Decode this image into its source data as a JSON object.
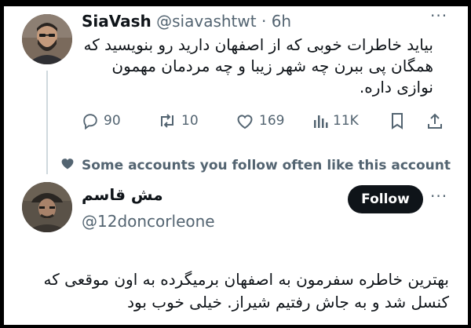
{
  "tweet": {
    "display_name": "SiaVash",
    "handle": "@siavashtwt",
    "separator": " · ",
    "time": "6h",
    "more_label": "···",
    "text": "بیاید خاطرات خوبی که از اصفهان دارید رو بنویسید که همگان پی ببرن چه شهر زیبا و چه مردمان مهمون نوازی داره.",
    "metrics": {
      "replies": "90",
      "retweets": "10",
      "likes": "169",
      "views": "11K"
    }
  },
  "recommendation": {
    "text": "Some accounts you follow often like this account"
  },
  "reply": {
    "display_name": "مش قاسم",
    "handle": "@12doncorleone",
    "follow_label": "Follow",
    "more_label": "···",
    "text": "بهترین خاطره سفرمون به اصفهان برمیگرده به اون موقعی که کنسل شد و به جاش رفتیم شیراز. خیلی خوب بود"
  },
  "colors": {
    "text_primary": "#0f1419",
    "text_secondary": "#536471",
    "follow_bg": "#0f1419",
    "follow_text": "#ffffff",
    "thread_line": "#cfd9de",
    "frame": "#000000"
  },
  "icons": [
    "reply-icon",
    "retweet-icon",
    "like-icon",
    "views-icon",
    "bookmark-icon",
    "share-icon",
    "heart-icon"
  ]
}
